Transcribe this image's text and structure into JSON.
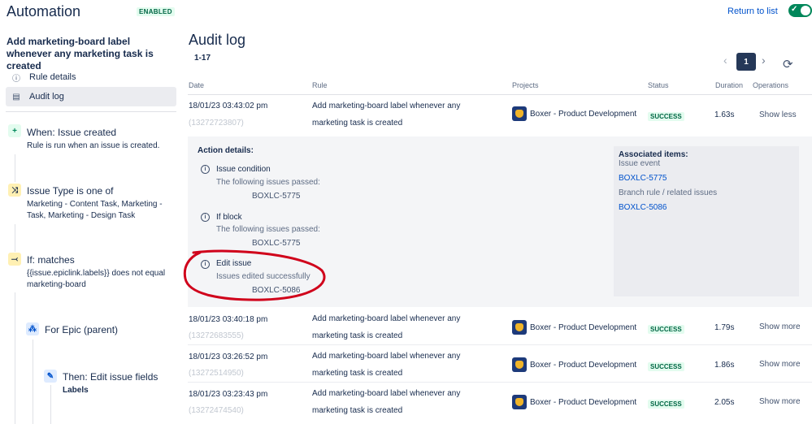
{
  "header": {
    "app_title": "Automation",
    "enabled_badge": "ENABLED",
    "return_link": "Return to list",
    "toggle_on": true
  },
  "sidebar": {
    "rule_title": "Add marketing-board label whenever any marketing task is created",
    "nav": [
      {
        "label": "Rule details",
        "icon": "info-icon",
        "active": false
      },
      {
        "label": "Audit log",
        "icon": "document-icon",
        "active": true
      }
    ],
    "steps": [
      {
        "icon": "plus-icon",
        "title": "When: Issue created",
        "desc": "Rule is run when an issue is created."
      },
      {
        "icon": "shuffle-icon",
        "title": "Issue Type is one of",
        "desc": "Marketing - Content Task, Marketing - Task, Marketing - Design Task"
      },
      {
        "icon": "branch-icon",
        "title": "If: matches",
        "desc": "{{issue.epiclink.labels}} does not equal marketing-board"
      },
      {
        "icon": "hierarchy-icon",
        "title": "For Epic (parent)",
        "desc": ""
      },
      {
        "icon": "pencil-icon",
        "title": "Then: Edit issue fields",
        "desc": "Labels"
      }
    ]
  },
  "main": {
    "heading": "Audit log",
    "range": "1-17",
    "pagination": {
      "current": "1",
      "prev": "‹",
      "next": "›"
    },
    "columns": [
      "Date",
      "Rule",
      "Projects",
      "Status",
      "Duration",
      "Operations"
    ],
    "rows": [
      {
        "date": "18/01/23 03:43:02 pm",
        "id": "(13272723807)",
        "rule_line1": "Add marketing-board label whenever any",
        "rule_line2": "marketing task is created",
        "project": "Boxer - Product Development",
        "status": "SUCCESS",
        "duration": "1.63s",
        "op": "Show less"
      },
      {
        "date": "18/01/23 03:40:18 pm",
        "id": "(13272683555)",
        "rule_line1": "Add marketing-board label whenever any",
        "rule_line2": "marketing task is created",
        "project": "Boxer - Product Development",
        "status": "SUCCESS",
        "duration": "1.79s",
        "op": "Show more"
      },
      {
        "date": "18/01/23 03:26:52 pm",
        "id": "(13272514950)",
        "rule_line1": "Add marketing-board label whenever any",
        "rule_line2": "marketing task is created",
        "project": "Boxer - Product Development",
        "status": "SUCCESS",
        "duration": "1.86s",
        "op": "Show more"
      },
      {
        "date": "18/01/23 03:23:43 pm",
        "id": "(13272474540)",
        "rule_line1": "Add marketing-board label whenever any",
        "rule_line2": "marketing task is created",
        "project": "Boxer - Product Development",
        "status": "SUCCESS",
        "duration": "2.05s",
        "op": "Show more"
      }
    ],
    "details": {
      "title": "Action details:",
      "actions": [
        {
          "name": "Issue condition",
          "sub": "The following issues passed:",
          "issue": "BOXLC-5775"
        },
        {
          "name": "If block",
          "sub": "The following issues passed:",
          "issue": "BOXLC-5775"
        },
        {
          "name": "Edit issue",
          "sub": "Issues edited successfully",
          "issue": "BOXLC-5086"
        }
      ],
      "associated": {
        "title": "Associated items:",
        "event_label": "Issue event",
        "event_link": "BOXLC-5775",
        "branch_label": "Branch rule / related issues",
        "branch_link": "BOXLC-5086"
      }
    }
  },
  "colors": {
    "accent": "#0052cc",
    "success": "#00875a",
    "annotation": "#d0021b"
  }
}
